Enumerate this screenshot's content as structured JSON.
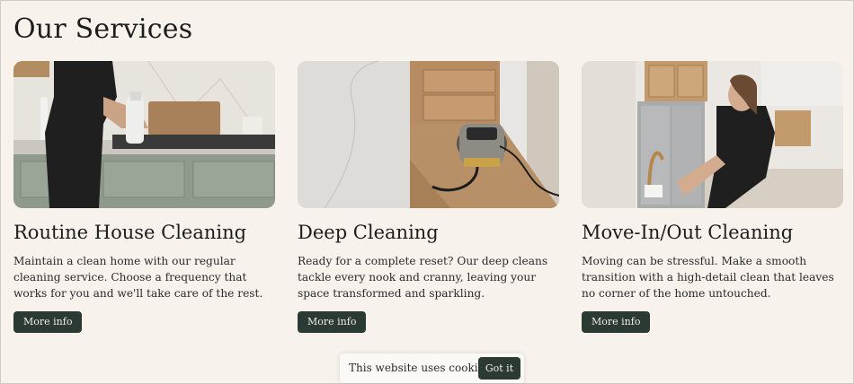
{
  "page": {
    "title": "Our Services"
  },
  "services": [
    {
      "title": "Routine House Cleaning",
      "description": "Maintain a clean home with our regular cleaning service. Choose a frequency that works for you and we'll take care of the rest.",
      "button_label": "More info",
      "image_icon": "kitchen-counter-cleaning-photo"
    },
    {
      "title": "Deep Cleaning",
      "description": "Ready for a complete reset? Our deep cleans tackle every nook and cranny, leaving your space transformed and sparkling.",
      "button_label": "More info",
      "image_icon": "steam-cleaner-photo"
    },
    {
      "title": "Move-In/Out Cleaning",
      "description": "Moving can be stressful. Make a smooth transition with a high-detail clean that leaves no corner of the home untouched.",
      "button_label": "More info",
      "image_icon": "kitchen-faucet-cleaning-photo"
    }
  ],
  "cookie_banner": {
    "text": "This website uses cookies",
    "button_label": "Got it"
  },
  "colors": {
    "background": "#f8f2ec",
    "button": "#2b3a32",
    "button_text": "#f2eee8"
  }
}
